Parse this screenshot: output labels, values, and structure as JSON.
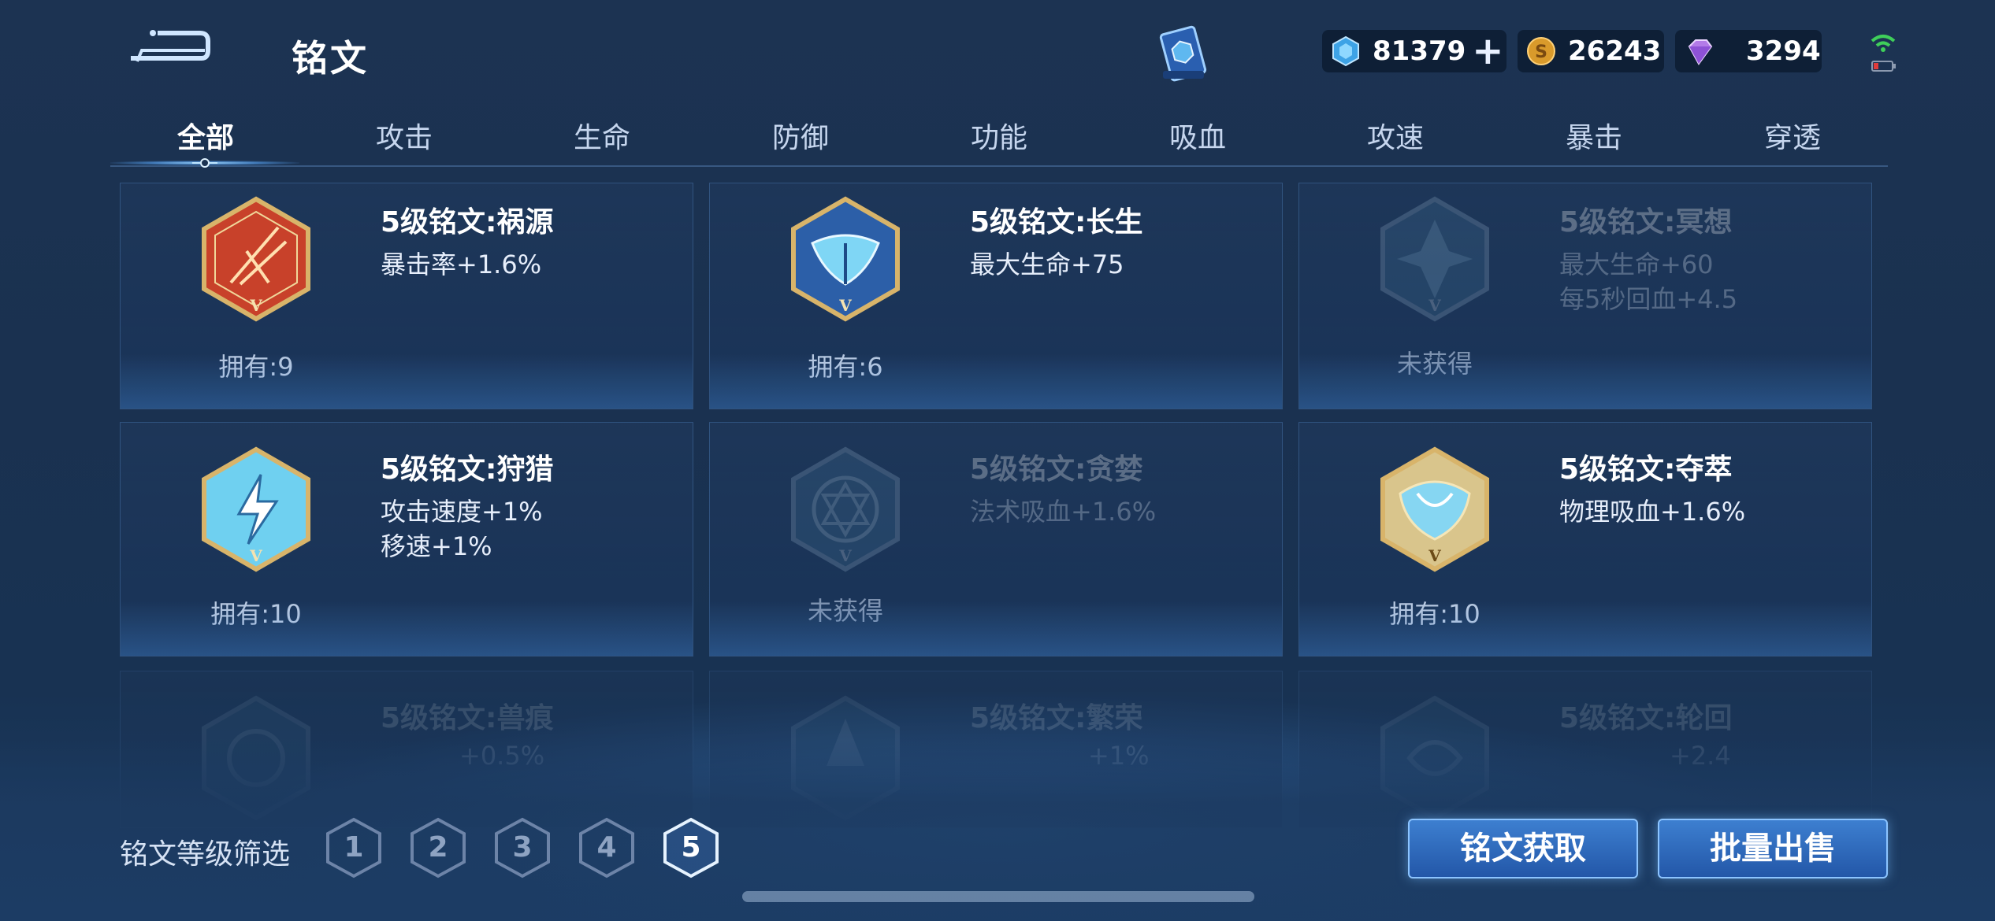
{
  "header": {
    "title": "铭文",
    "currencies": [
      {
        "icon": "diamond-icon",
        "value": "81379",
        "has_plus": true
      },
      {
        "icon": "gold-coin-icon",
        "value": "26243"
      },
      {
        "icon": "purple-gem-icon",
        "value": "3294"
      }
    ],
    "plus_symbol": "+"
  },
  "tabs": [
    {
      "label": "全部",
      "active": true
    },
    {
      "label": "攻击"
    },
    {
      "label": "生命"
    },
    {
      "label": "防御"
    },
    {
      "label": "功能"
    },
    {
      "label": "吸血"
    },
    {
      "label": "攻速"
    },
    {
      "label": "暴击"
    },
    {
      "label": "穿透"
    }
  ],
  "runes": [
    {
      "name": "5级铭文:祸源",
      "stats": [
        "暴击率+1.6%"
      ],
      "owned": "拥有:9",
      "color": "red",
      "unlocked": true
    },
    {
      "name": "5级铭文:长生",
      "stats": [
        "最大生命+75"
      ],
      "owned": "拥有:6",
      "color": "blue",
      "unlocked": true
    },
    {
      "name": "5级铭文:冥想",
      "stats": [
        "最大生命+60",
        "每5秒回血+4.5"
      ],
      "owned": "未获得",
      "color": "teal",
      "unlocked": false
    },
    {
      "name": "5级铭文:狩猎",
      "stats": [
        "攻击速度+1%",
        "移速+1%"
      ],
      "owned": "拥有:10",
      "color": "cyan",
      "unlocked": true
    },
    {
      "name": "5级铭文:贪婪",
      "stats": [
        "法术吸血+1.6%"
      ],
      "owned": "未获得",
      "color": "teal",
      "unlocked": false
    },
    {
      "name": "5级铭文:夺萃",
      "stats": [
        "物理吸血+1.6%"
      ],
      "owned": "拥有:10",
      "color": "cyan",
      "unlocked": true
    },
    {
      "name": "5级铭文:兽痕",
      "stats": [
        "+0.5%"
      ],
      "owned": "",
      "color": "teal",
      "unlocked": false
    },
    {
      "name": "5级铭文:繁荣",
      "stats": [
        "+1%"
      ],
      "owned": "",
      "color": "teal",
      "unlocked": false
    },
    {
      "name": "5级铭文:轮回",
      "stats": [
        "+2.4"
      ],
      "owned": "",
      "color": "teal",
      "unlocked": false
    }
  ],
  "emblem_letter": "V",
  "filter": {
    "label": "铭文等级筛选",
    "levels": [
      "1",
      "2",
      "3",
      "4",
      "5"
    ],
    "selected": "5"
  },
  "buttons": {
    "acquire": "铭文获取",
    "sell": "批量出售"
  },
  "colors": {
    "red": "#c8412a",
    "blue": "#2c5fa8",
    "cyan": "#6fd0f0",
    "teal": "#3d6d8f",
    "gold": "#d8b46a",
    "button": "#2f6cc0"
  }
}
